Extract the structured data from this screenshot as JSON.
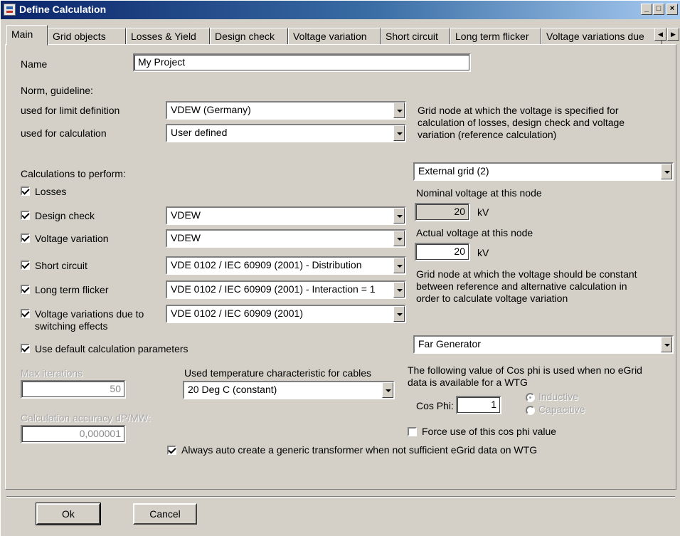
{
  "window": {
    "title": "Define Calculation"
  },
  "titlebar_buttons": {
    "minimize": "_",
    "maximize": "□",
    "close": "×"
  },
  "tabs": [
    {
      "label": "Main"
    },
    {
      "label": "Grid objects"
    },
    {
      "label": "Losses & Yield"
    },
    {
      "label": "Design check"
    },
    {
      "label": "Voltage variation"
    },
    {
      "label": "Short circuit"
    },
    {
      "label": "Long term flicker"
    },
    {
      "label": "Voltage variations due"
    }
  ],
  "tab_scroll": {
    "left": "◀",
    "right": "▶"
  },
  "name": {
    "label": "Name",
    "value": "My Project"
  },
  "norm": {
    "heading": "Norm, guideline:",
    "limit_label": "used for limit definition",
    "limit_value": "VDEW (Germany)",
    "calc_label": "used for calculation",
    "calc_value": "User defined"
  },
  "calculations": {
    "heading": "Calculations to perform:",
    "losses": "Losses",
    "design_check": "Design check",
    "design_check_value": "VDEW",
    "voltage_variation": "Voltage variation",
    "voltage_variation_value": "VDEW",
    "short_circuit": "Short circuit",
    "short_circuit_value": "VDE 0102 / IEC 60909 (2001) - Distribution",
    "long_term_flicker": "Long term flicker",
    "long_term_flicker_value": "VDE 0102 / IEC 60909 (2001) - Interaction = 1",
    "switching_line1": "Voltage variations due to",
    "switching_line2": "switching effects",
    "switching_value": "VDE 0102 / IEC 60909 (2001)",
    "use_default": "Use default calculation parameters"
  },
  "params": {
    "max_iter_label": "Max iterations",
    "max_iter_value": "50",
    "accuracy_label": "Calculation accuracy dP/MW:",
    "accuracy_value": "0,000001",
    "temp_label": "Used temperature characteristic for cables",
    "temp_value": "20 Deg C (constant)",
    "auto_transformer": "Always auto create a generic transformer when not sufficient eGrid data on WTG"
  },
  "right": {
    "ref_node_line1": "Grid node at which the voltage is specified for",
    "ref_node_line2": "calculation of losses, design check and voltage",
    "ref_node_line3": "variation (reference calculation)",
    "ref_node_value": "External grid (2)",
    "nominal_label": "Nominal voltage at this node",
    "nominal_value": "20",
    "nominal_unit": "kV",
    "actual_label": "Actual voltage at this node",
    "actual_value": "20",
    "actual_unit": "kV",
    "const_node_line1": "Grid node at which the voltage should be constant",
    "const_node_line2": "between reference and alternative calculation in",
    "const_node_line3": "order to calculate voltage variation",
    "const_node_value": "Far Generator",
    "cosphi_line1": "The following value of Cos phi is used when no eGrid",
    "cosphi_line2": "data is available for a WTG",
    "cosphi_label": "Cos Phi:",
    "cosphi_value": "1",
    "inductive": "Inductive",
    "capacitive": "Capacitive",
    "force": "Force use of this cos phi value"
  },
  "buttons": {
    "ok": "Ok",
    "cancel": "Cancel"
  }
}
